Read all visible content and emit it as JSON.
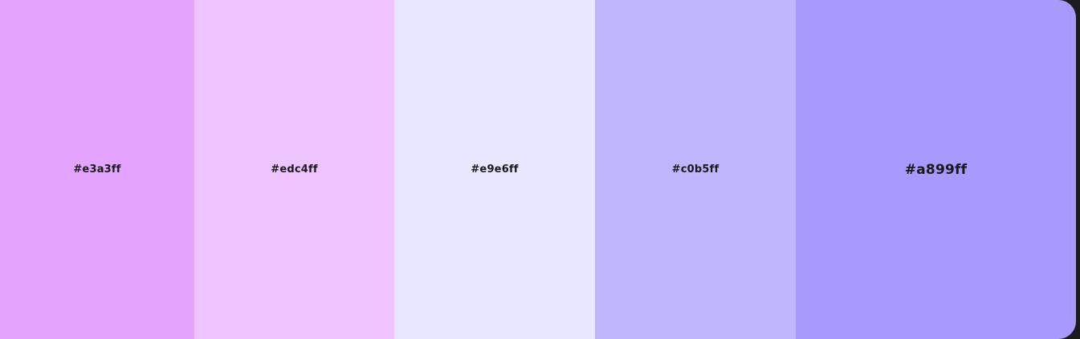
{
  "palette": {
    "swatches": [
      {
        "hex_label": "#e3a3ff",
        "color": "#e3a3ff"
      },
      {
        "hex_label": "#edc4ff",
        "color": "#edc4ff"
      },
      {
        "hex_label": "#e9e6ff",
        "color": "#e9e6ff"
      },
      {
        "hex_label": "#c0b5ff",
        "color": "#c0b5ff"
      },
      {
        "hex_label": "#a899ff",
        "color": "#a899ff"
      }
    ],
    "active_index": 4
  }
}
